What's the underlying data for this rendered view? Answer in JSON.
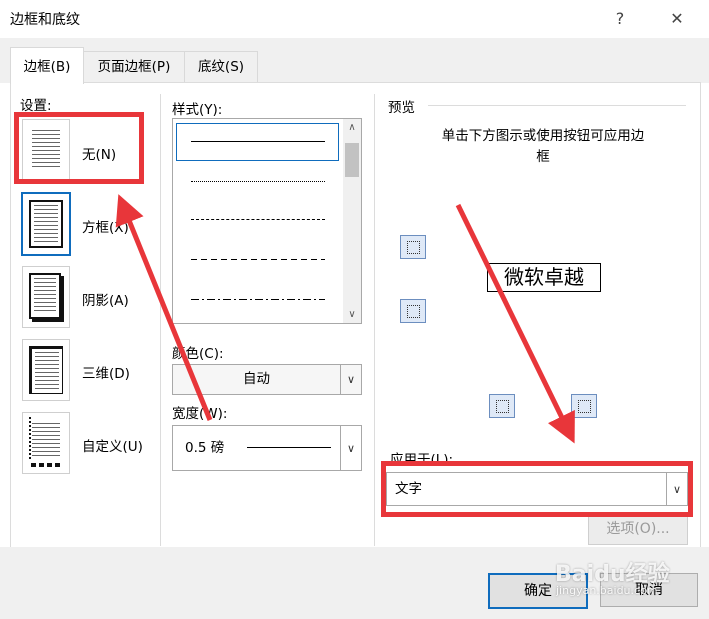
{
  "window": {
    "title": "边框和底纹",
    "help": "?",
    "close": "✕"
  },
  "tabs": [
    {
      "label": "边框(B)",
      "active": true
    },
    {
      "label": "页面边框(P)",
      "active": false
    },
    {
      "label": "底纹(S)",
      "active": false
    }
  ],
  "settings": {
    "heading": "设置:",
    "items": [
      {
        "label": "无(N)",
        "icon": "none-border-icon"
      },
      {
        "label": "方框(X)",
        "icon": "box-border-icon"
      },
      {
        "label": "阴影(A)",
        "icon": "shadow-border-icon"
      },
      {
        "label": "三维(D)",
        "icon": "3d-border-icon"
      },
      {
        "label": "自定义(U)",
        "icon": "custom-border-icon"
      }
    ]
  },
  "style": {
    "heading": "样式(Y):",
    "options": [
      "solid",
      "dotted",
      "dashed-small",
      "dashed",
      "dash-dot"
    ]
  },
  "color": {
    "label": "颜色(C):",
    "value": "自动"
  },
  "width": {
    "label": "宽度(W):",
    "value": "0.5 磅"
  },
  "preview": {
    "heading": "预览",
    "instruction": "单击下方图示或使用按钮可应用边框",
    "sample_text": "微软卓越"
  },
  "apply_to": {
    "label": "应用于(L):",
    "value": "文字"
  },
  "buttons": {
    "options": "选项(O)...",
    "ok": "确定",
    "cancel": "取消"
  },
  "watermark": {
    "brand": "Baidu经验",
    "url": "jingyan.baidu.com"
  },
  "colors": {
    "annotation": "#e8363a",
    "selection": "#0f6cbd"
  }
}
